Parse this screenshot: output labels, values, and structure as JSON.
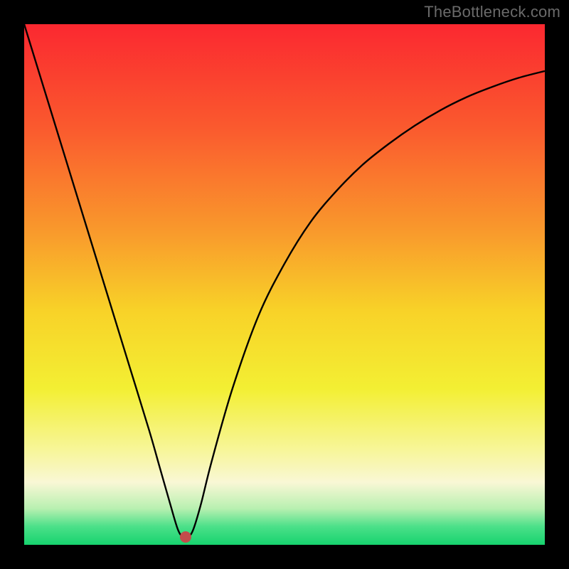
{
  "watermark": "TheBottleneck.com",
  "chart_data": {
    "type": "line",
    "title": "",
    "xlabel": "",
    "ylabel": "",
    "xlim": [
      0,
      100
    ],
    "ylim": [
      0,
      100
    ],
    "background_gradient": {
      "stops": [
        {
          "offset": 0.0,
          "color": "#fb2830"
        },
        {
          "offset": 0.2,
          "color": "#fa5a2e"
        },
        {
          "offset": 0.4,
          "color": "#f99a2c"
        },
        {
          "offset": 0.55,
          "color": "#f8d228"
        },
        {
          "offset": 0.7,
          "color": "#f3ef33"
        },
        {
          "offset": 0.82,
          "color": "#f7f69b"
        },
        {
          "offset": 0.88,
          "color": "#f9f7d5"
        },
        {
          "offset": 0.93,
          "color": "#b9f0b1"
        },
        {
          "offset": 0.965,
          "color": "#4be089"
        },
        {
          "offset": 1.0,
          "color": "#17d36e"
        }
      ]
    },
    "series": [
      {
        "name": "bottleneck-curve",
        "color": "#000000",
        "x": [
          0,
          4,
          8,
          12,
          16,
          20,
          24,
          26,
          28,
          29.5,
          30.5,
          31.5,
          32.5,
          34,
          36,
          40,
          45,
          50,
          55,
          60,
          65,
          70,
          75,
          80,
          85,
          90,
          95,
          100
        ],
        "y": [
          100,
          87,
          74,
          61,
          48,
          35,
          22,
          15,
          8,
          3,
          1.5,
          1.5,
          3,
          8,
          16,
          30,
          44,
          54,
          62,
          68,
          73,
          77,
          80.5,
          83.5,
          86,
          88,
          89.7,
          91
        ]
      }
    ],
    "marker": {
      "x": 31,
      "y": 1.5,
      "r": 1.2,
      "color": "#c44b4b"
    }
  }
}
